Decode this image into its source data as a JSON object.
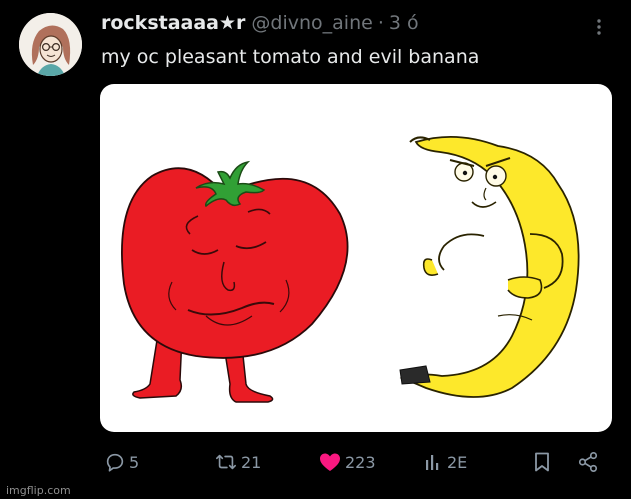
{
  "tweet": {
    "display_name": "rockstaaaa★r",
    "handle": "@divno_aine",
    "separator": "·",
    "time": "3 ó",
    "text": "my oc pleasant tomato and evil banana"
  },
  "media": {
    "icons": [
      "tomato-character",
      "banana-character"
    ]
  },
  "actions": {
    "replies": "5",
    "reposts": "21",
    "likes": "223",
    "views": "2E"
  },
  "watermark": "imgflip.com",
  "colors": {
    "background": "#000000",
    "text": "#e7e9ea",
    "muted": "#71767b",
    "like": "#f91880",
    "tomato": "#ea1c24",
    "banana": "#fde82b"
  }
}
